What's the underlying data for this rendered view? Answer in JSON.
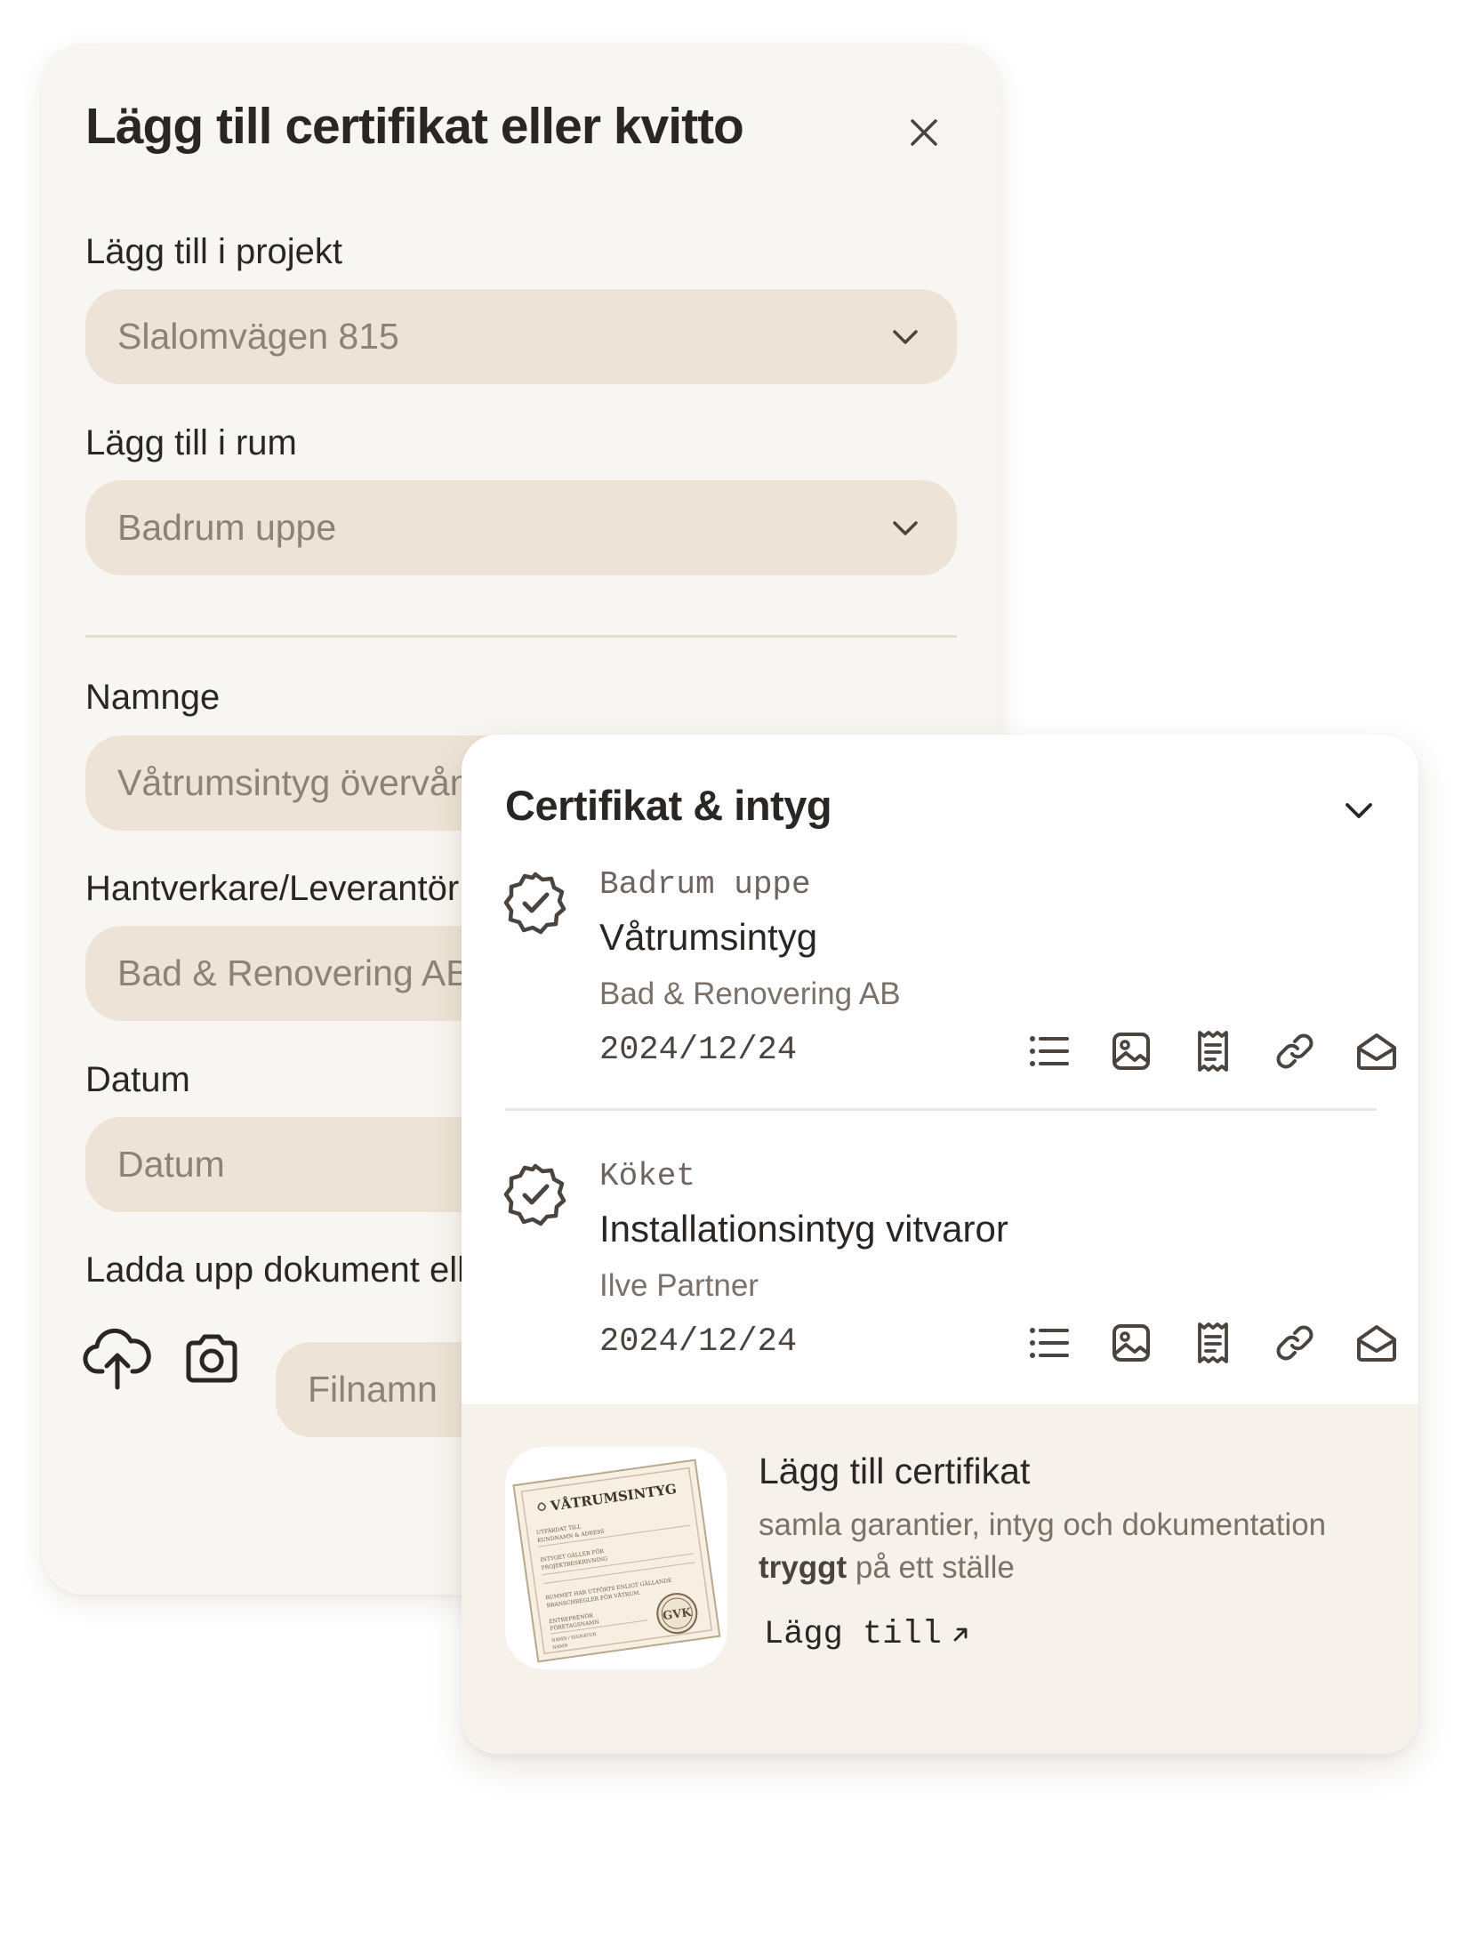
{
  "form": {
    "title": "Lägg till certifikat eller kvitto",
    "project_label": "Lägg till i projekt",
    "project_value": "Slalomvägen 815",
    "room_label": "Lägg till i rum",
    "room_value": "Badrum uppe",
    "name_label": "Namnge",
    "name_value": "Våtrumsintyg övervåning",
    "vendor_label": "Hantverkare/Leverantör",
    "vendor_value": "Bad & Renovering AB",
    "date_label": "Datum",
    "date_placeholder": "Datum",
    "upload_label": "Ladda upp dokument eller foto",
    "filename_placeholder": "Filnamn"
  },
  "card": {
    "title": "Certifikat & intyg",
    "certificates": [
      {
        "room": "Badrum uppe",
        "name": "Våtrumsintyg",
        "vendor": "Bad & Renovering AB",
        "date": "2024/12/24"
      },
      {
        "room": "Köket",
        "name": "Installationsintyg vitvaror",
        "vendor": "Ilve Partner",
        "date": "2024/12/24"
      }
    ],
    "action_icons": [
      "list-icon",
      "image-icon",
      "receipt-icon",
      "link-icon",
      "mail-open-icon"
    ]
  },
  "promo": {
    "title": "Lägg till certifikat",
    "text_before": "samla garantier, intyg och dokumentation",
    "text_bold": "tryggt",
    "text_after": " på ett ställe",
    "link": "Lägg till",
    "image": {
      "heading": "VÅTRUMSINTYG",
      "line1": "UTFÄRDAT TILL",
      "line2": "KUNDNAMN & ADRESS",
      "line3": "INTYGET GÄLLER FÖR",
      "line4": "PROJEKTBESKRIVNING",
      "line5": "RUMMET HAR UTFÖRTS ENLIGT GÄLLANDE",
      "line6": "BRANSCHREGLER FÖR VÅTRUM.",
      "line7": "ENTREPRENÖR",
      "line8": "FÖRETAGSNAMN",
      "line9": "NAMN / SIGNATUR",
      "line10": "NAMN",
      "seal": "GVK"
    }
  },
  "colors": {
    "panel_bg": "#f8f6f2",
    "field_bg": "#ede4d7",
    "promo_bg": "#f6f1ea",
    "text_dark": "#2a2623",
    "text_muted": "#8c8278"
  }
}
